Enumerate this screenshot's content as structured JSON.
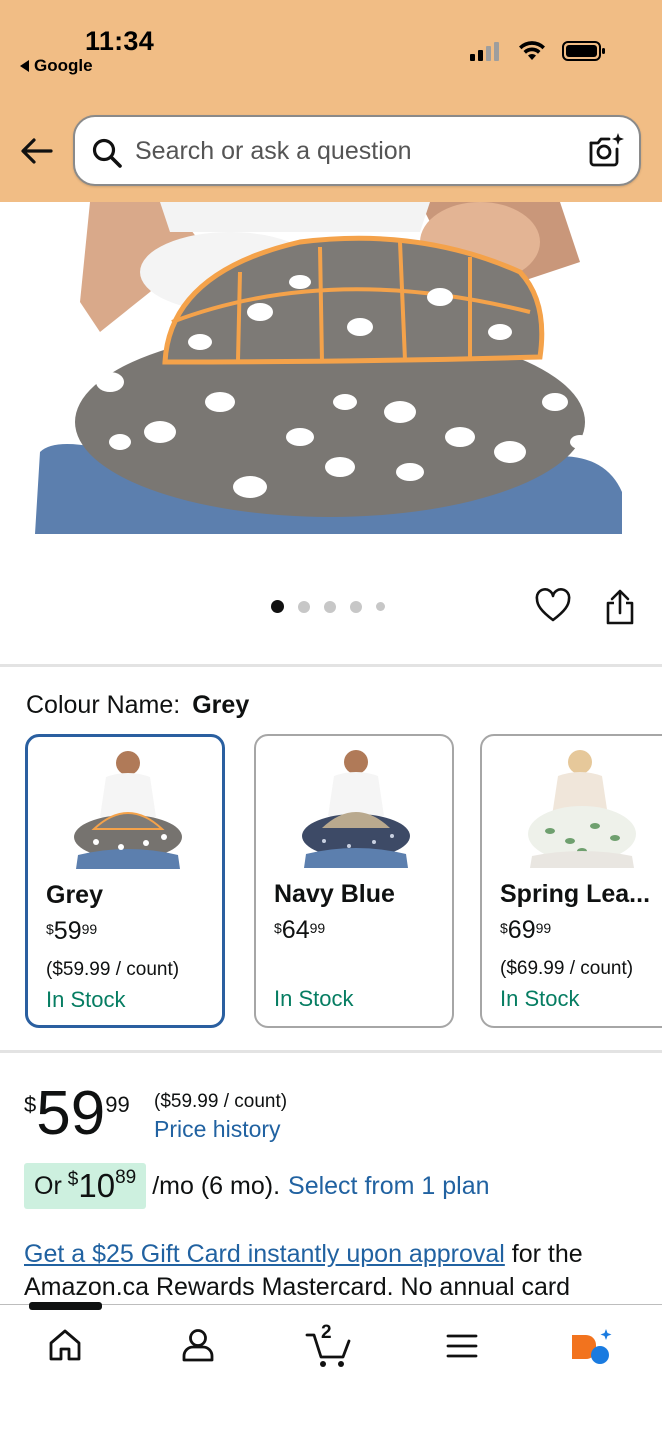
{
  "status_bar": {
    "time": "11:34",
    "back_app": "Google"
  },
  "search": {
    "placeholder": "Search or ask a question"
  },
  "carousel": {
    "dot_count": 5,
    "active_index": 0
  },
  "variation": {
    "label": "Colour Name:",
    "selected": "Grey",
    "options": [
      {
        "name": "Grey",
        "price_currency": "$",
        "price_whole": "59",
        "price_fraction": "99",
        "unit_price": "($59.99 / count)",
        "stock": "In Stock"
      },
      {
        "name": "Navy Blue",
        "price_currency": "$",
        "price_whole": "64",
        "price_fraction": "99",
        "unit_price": "",
        "stock": "In Stock"
      },
      {
        "name": "Spring Lea...",
        "price_currency": "$",
        "price_whole": "69",
        "price_fraction": "99",
        "unit_price": "($69.99 / count)",
        "stock": "In Stock"
      }
    ]
  },
  "price": {
    "currency": "$",
    "whole": "59",
    "fraction": "99",
    "unit_price": "($59.99 / count)",
    "price_history": "Price history"
  },
  "monthly": {
    "prefix": "Or",
    "currency": "$",
    "whole": "10",
    "fraction": "89",
    "suffix": "/mo (6 mo).",
    "plan_link": "Select from 1 plan"
  },
  "gift_card": {
    "link": "Get a $25 Gift Card instantly upon approval",
    "text": " for the Amazon.ca Rewards Mastercard. No annual card"
  },
  "bottom_nav": {
    "cart_count": "2",
    "items": [
      "home-icon",
      "account-icon",
      "cart-icon",
      "menu-icon",
      "rufus-icon"
    ]
  },
  "colors": {
    "header_bg": "#f1bd85",
    "link": "#2162a1",
    "in_stock": "#067d62",
    "selected_border": "#2a5fa0",
    "deal_pill": "#cdf0df"
  }
}
